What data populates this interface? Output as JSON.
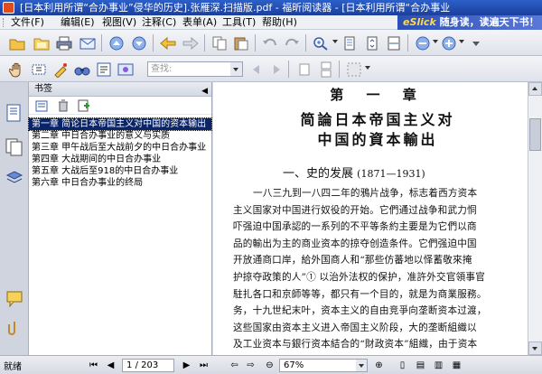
{
  "window": {
    "title": "[日本利用所谓“合办事业”侵华的历史].张雁深.扫描版.pdf - 福昕阅读器 - [日本利用所谓“合办事业"
  },
  "menu": {
    "items": [
      {
        "label": "文件(F)"
      },
      {
        "label": "编辑(E)"
      },
      {
        "label": "视图(V)"
      },
      {
        "label": "注释(C)"
      },
      {
        "label": "表单(A)"
      },
      {
        "label": "工具(T)"
      },
      {
        "label": "帮助(H)"
      }
    ]
  },
  "brand": {
    "name": "eSlick",
    "slogan": "随身读，读遍天下书！"
  },
  "toolbar2": {
    "find_placeholder": "查找:"
  },
  "bookmarks": {
    "title": "书签",
    "items": [
      {
        "label": "第一章 简论日本帝国主义对中国的资本输出",
        "selected": true
      },
      {
        "label": "第二章 中日合办事业的意义与实质",
        "selected": false
      },
      {
        "label": "第三章 甲午战后至大战前夕的中日合办事业",
        "selected": false
      },
      {
        "label": "第四章 大战期间的中日合办事业",
        "selected": false
      },
      {
        "label": "第五章 大战后至918的中日合办事业",
        "selected": false
      },
      {
        "label": "第六章 中日合办事业的终局",
        "selected": false
      }
    ]
  },
  "document": {
    "chapter": "第 一 章",
    "title_line1": "简論日本帝国主义对",
    "title_line2": "中国的資本輸出",
    "section": "一、史的发展",
    "section_years": "(1871—1931)",
    "lines": [
      "一八三九到一八四二年的鴉片战争，标志着西方资本",
      "主义国家对中国进行奴役的开始。它們通过战争和武力恫",
      "吓强迫中国承認的一系列的不平等条約主要是为它們以商",
      "品的輸出为主的商业资本的掠夺创造条件。它們强迫中国",
      "开放通商口岸，給外国商人和“那些仿蕃地以怿蓄敬來掩",
      "护掠夺政策的人”① 以治外法权的保护，准許外交官領事官",
      "駐扎各口和京師等等，都只有一个目的，就是为商業服務。",
      "务，十九世紀末叶，资本主义的自由竞爭向垄断资本过渡，",
      "这些国家由资本主义进入帝国主义阶段，大的垄断組織以",
      "及工业资本与銀行资本結合的“財政资本”組織，由于资本"
    ]
  },
  "status": {
    "ready": "就绪",
    "page_current": "1",
    "page_sep": "/",
    "page_total": "203",
    "zoom": "67%"
  },
  "colors": {
    "title_bar": "#1b3f9c",
    "selection": "#0a246a",
    "toolbar_bg": "#e8eaf0"
  }
}
